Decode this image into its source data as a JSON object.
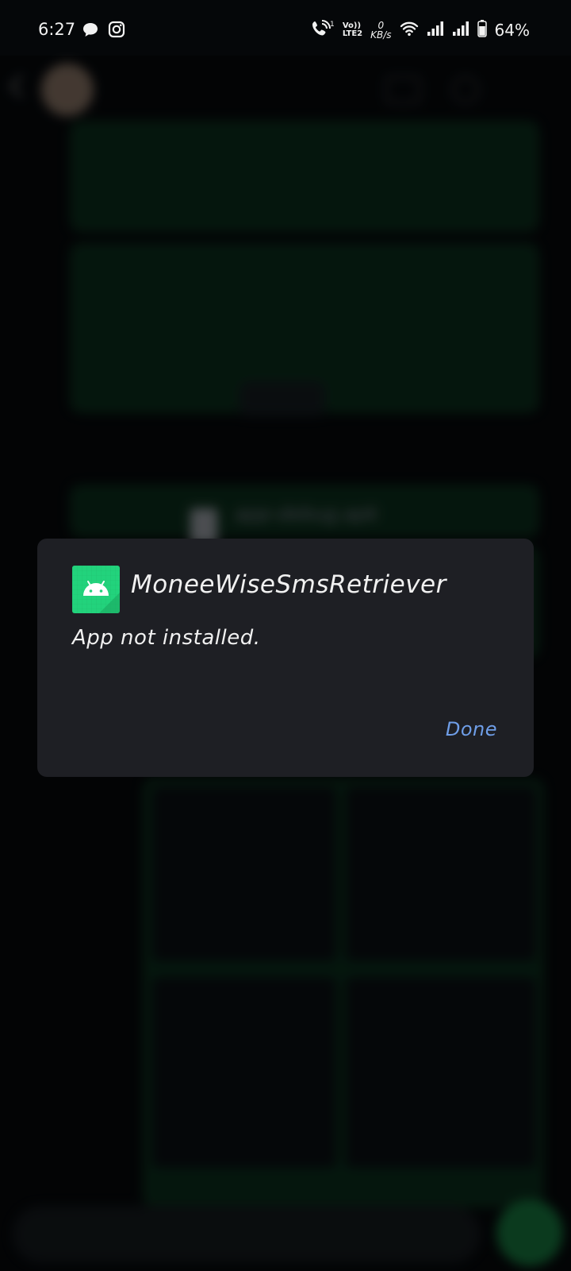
{
  "status_bar": {
    "time": "6:27",
    "volte_line1": "Vo))",
    "volte_line2": "LTE2",
    "speed_value": "0",
    "speed_unit": "KB/s",
    "battery": "64%",
    "icons": [
      "chat-bubble-icon",
      "instagram-icon",
      "wifi-call-icon",
      "wifi-icon",
      "signal-icon",
      "signal-icon",
      "battery-icon"
    ]
  },
  "background": {
    "attachment_name": "app-debug.apk",
    "attachment_type": "APK"
  },
  "dialog": {
    "app_name": "MoneeWiseSmsRetriever",
    "message": "App not installed.",
    "done_label": "Done"
  },
  "colors": {
    "dialog_bg": "#1e1f24",
    "app_icon_bg": "#22d37c",
    "done_text": "#6f9ee8"
  }
}
